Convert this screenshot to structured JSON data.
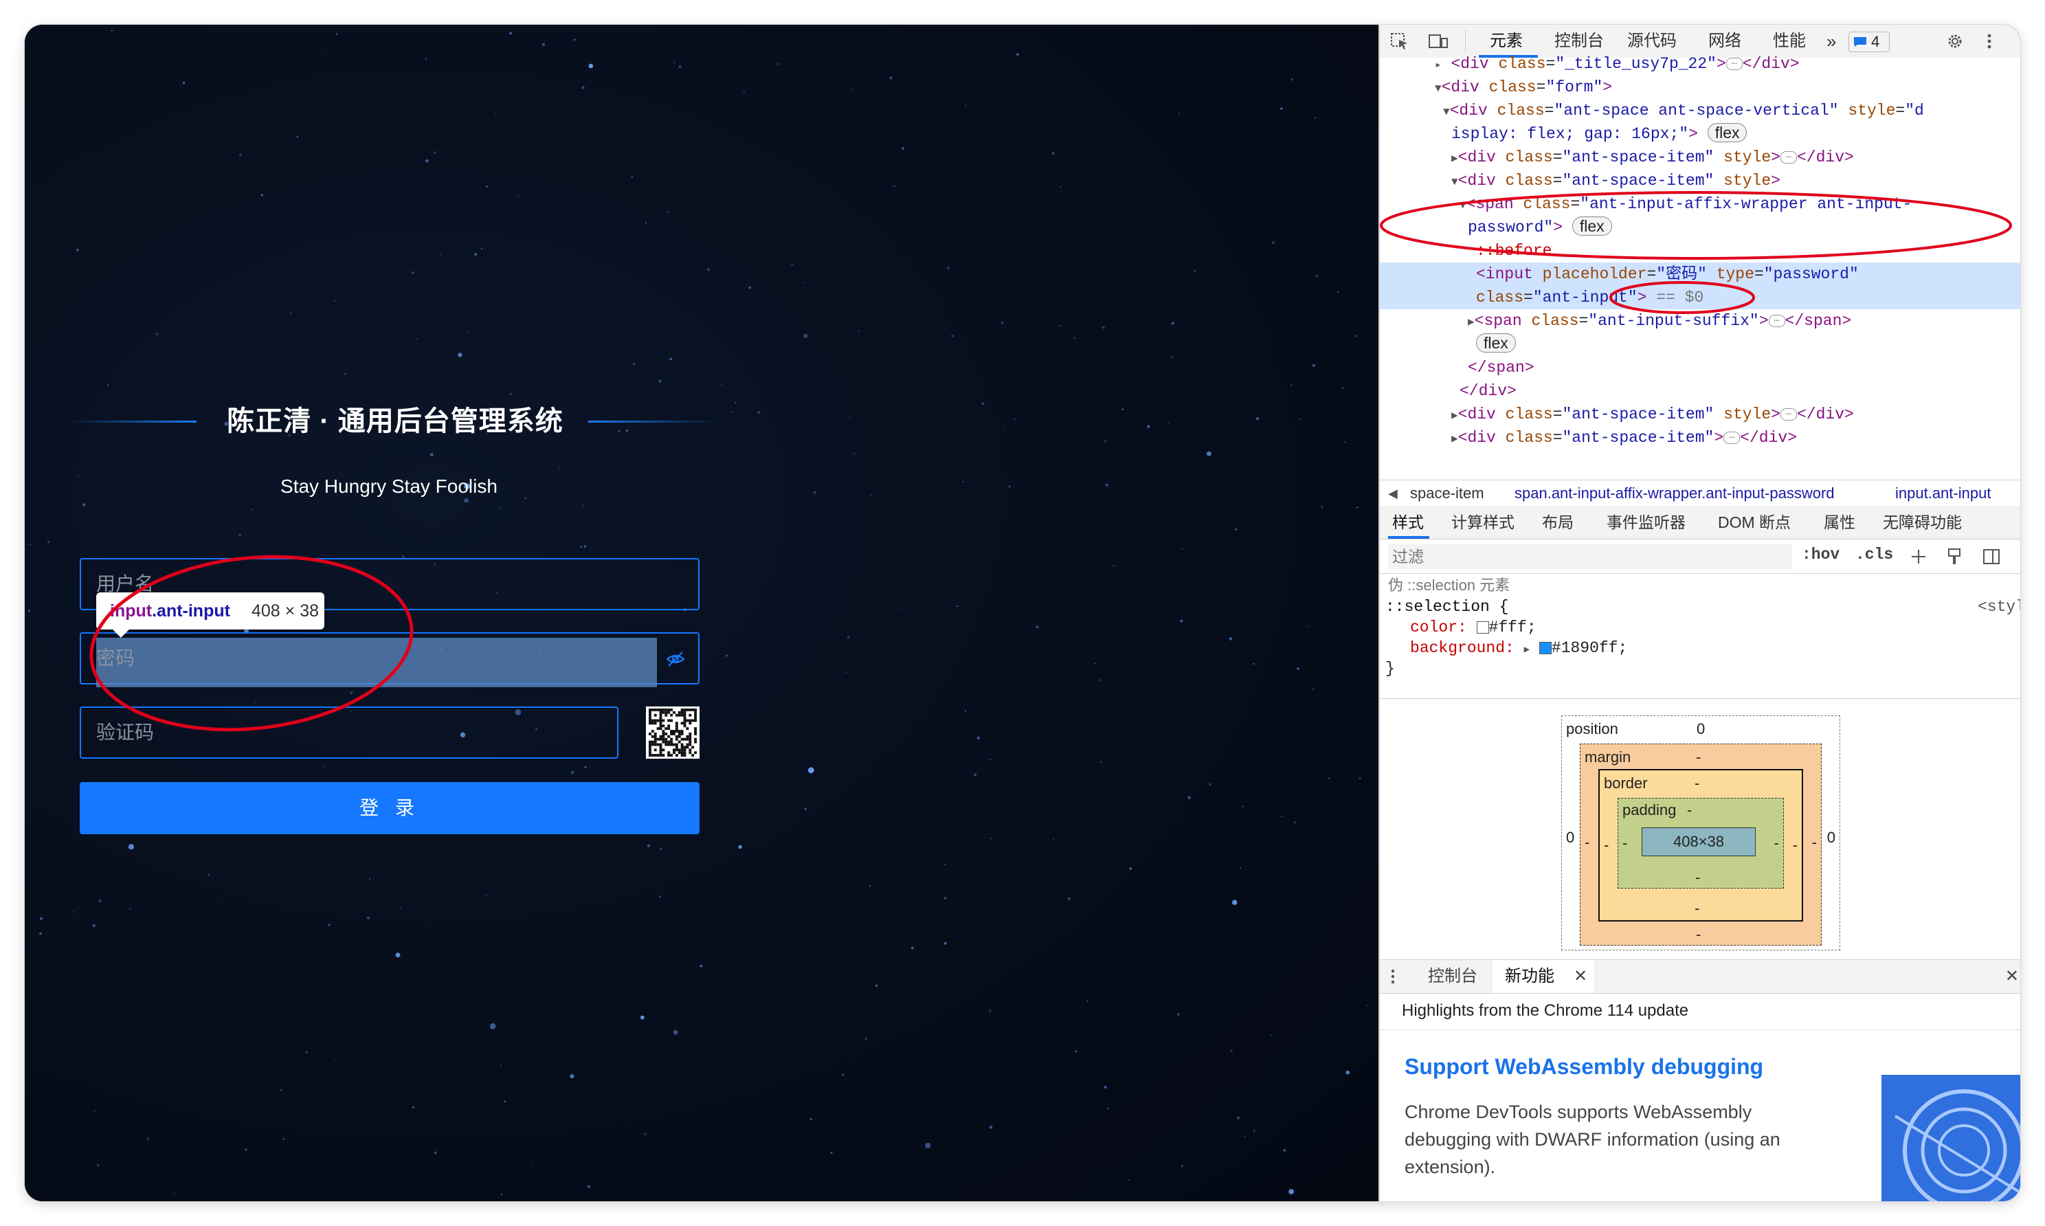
{
  "login": {
    "title": "陈正清 · 通用后台管理系统",
    "slogan": "Stay Hungry Stay Foolish",
    "username_placeholder": "用户名",
    "password_placeholder": "密码",
    "captcha_placeholder": "验证码",
    "login_button": "登 录"
  },
  "inspect_tooltip": {
    "tag": "input",
    "class": ".ant-input",
    "size": "408 × 38"
  },
  "devtools": {
    "tabs": [
      "元素",
      "控制台",
      "源代码",
      "网络",
      "性能",
      "»"
    ],
    "issues_count": "4",
    "dom_lines": [
      {
        "indent": 6,
        "html": "<span class=\"tri\">▸</span> <span class=\"tag\">&lt;div</span> <span class=\"attr\">class</span>=<span class=\"val\">\"_title_usy7p_22\"</span><span class=\"tag\">&gt;</span><span class=\"dots\">…</span><span class=\"tag\">&lt;/div&gt;</span>"
      },
      {
        "indent": 6,
        "html": "<span class=\"tri\">▼</span><span class=\"tag\">&lt;div</span> <span class=\"attr\">class</span>=<span class=\"val\">\"form\"</span><span class=\"tag\">&gt;</span>"
      },
      {
        "indent": 7,
        "html": "<span class=\"tri\">▼</span><span class=\"tag\">&lt;div</span> <span class=\"attr\">class</span>=<span class=\"val\">\"ant-space ant-space-vertical\"</span> <span class=\"attr\">style</span>=<span class=\"val\">\"d</span>"
      },
      {
        "indent": 8,
        "html": "<span class=\"val\">isplay: flex; gap: 16px;\"</span><span class=\"tag\">&gt;</span> <span class=\"pill\">flex</span>"
      },
      {
        "indent": 8,
        "html": "<span class=\"tri\">▶</span><span class=\"tag\">&lt;div</span> <span class=\"attr\">class</span>=<span class=\"val\">\"ant-space-item\"</span> <span class=\"attr\">style</span><span class=\"tag\">&gt;</span><span class=\"dots\">…</span><span class=\"tag\">&lt;/div&gt;</span>"
      },
      {
        "indent": 8,
        "html": "<span class=\"tri\">▼</span><span class=\"tag\">&lt;div</span> <span class=\"attr\">class</span>=<span class=\"val\">\"ant-space-item\"</span> <span class=\"attr\">style</span><span class=\"tag\">&gt;</span>"
      },
      {
        "indent": 9,
        "html": "<span class=\"tri\">▼</span><span class=\"tag\">&lt;span</span> <span class=\"attr\">class</span>=<span class=\"val\">\"ant-input-affix-wrapper ant-input-</span>"
      },
      {
        "indent": 10,
        "html": "<span class=\"val\">password\"</span><span class=\"tag\">&gt;</span> <span class=\"pill\">flex</span>"
      },
      {
        "indent": 11,
        "html": "<span class=\"pseudo\">::before</span>"
      },
      {
        "indent": 11,
        "html": "<span class=\"tag\">&lt;input</span> <span class=\"attr\">placeholder</span>=<span class=\"val\">\"密码\"</span> <span class=\"attr\">type</span>=<span class=\"val\">\"password\"</span>"
      },
      {
        "indent": 11,
        "html": "<span class=\"attr\">class</span>=<span class=\"val\">\"ant-input\"</span><span class=\"tag\">&gt;</span> <span style=\"color:#777\">== $0</span>"
      },
      {
        "indent": 10,
        "html": "<span class=\"tri\">▶</span><span class=\"tag\">&lt;span</span> <span class=\"attr\">class</span>=<span class=\"val\">\"ant-input-suffix\"</span><span class=\"tag\">&gt;</span><span class=\"dots\">…</span><span class=\"tag\">&lt;/span&gt;</span>"
      },
      {
        "indent": 11,
        "html": "<span class=\"pill\">flex</span>"
      },
      {
        "indent": 10,
        "html": "<span class=\"tag\">&lt;/span&gt;</span>"
      },
      {
        "indent": 9,
        "html": "<span class=\"tag\">&lt;/div&gt;</span>"
      },
      {
        "indent": 8,
        "html": "<span class=\"tri\">▶</span><span class=\"tag\">&lt;div</span> <span class=\"attr\">class</span>=<span class=\"val\">\"ant-space-item\"</span> <span class=\"attr\">style</span><span class=\"tag\">&gt;</span><span class=\"dots\">…</span><span class=\"tag\">&lt;/div&gt;</span>"
      },
      {
        "indent": 8,
        "html": "<span class=\"tri\">▶</span><span class=\"tag\">&lt;div</span> <span class=\"attr\">class</span>=<span class=\"val\">\"ant-space-item\"</span><span class=\"tag\">&gt;</span><span class=\"dots\">…</span><span class=\"tag\">&lt;/div&gt;</span>"
      }
    ],
    "breadcrumbs": [
      "space-item",
      "span.ant-input-affix-wrapper.ant-input-password",
      "input.ant-input"
    ],
    "styles_tabs": [
      "样式",
      "计算样式",
      "布局",
      "事件监听器",
      "DOM 断点",
      "属性",
      "无障碍功能"
    ],
    "filter_placeholder": "过滤",
    "filter_hov": ":hov",
    "filter_cls": ".cls",
    "pseudo_header": "伪 ::selection 元素",
    "rule_selector": "::selection {",
    "rule_source": "<style>",
    "rule_color_prop": "color:",
    "rule_color_val": "#fff;",
    "rule_bg_prop": "background:",
    "rule_bg_val": "#1890ff;",
    "rule_close": "}",
    "box_position_label": "position",
    "box_position_val": "0",
    "box_margin_label": "margin",
    "box_border_label": "border",
    "box_padding_label": "padding",
    "box_content": "408×38",
    "box_dash": "-",
    "box_zero": "0",
    "drawer_tabs": [
      "控制台",
      "新功能"
    ],
    "whatsnew_header": "Highlights from the Chrome 114 update",
    "feature_title": "Support WebAssembly debugging",
    "feature_desc": "Chrome DevTools supports WebAssembly debugging with DWARF information (using an extension)."
  },
  "colors": {
    "accent": "#1677ff",
    "annotation": "#e0001b",
    "selection_bg": "#1890ff"
  }
}
